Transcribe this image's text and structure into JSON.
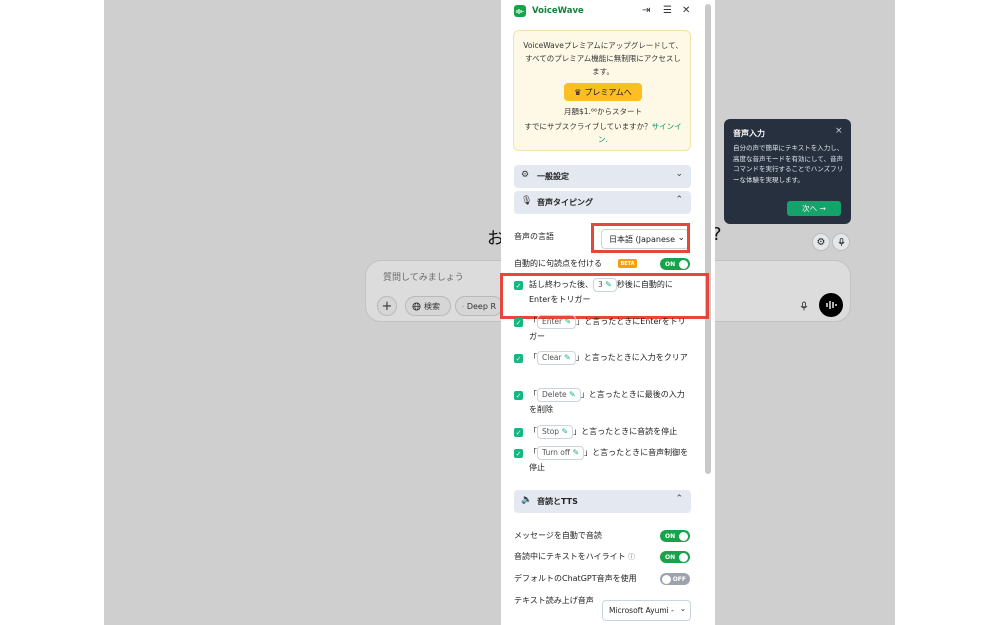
{
  "background": {
    "greeting_left": "お",
    "greeting_right": "?",
    "composer_placeholder": "質問してみましょう",
    "plus_label": "+",
    "search_label": "検索",
    "deep_research_label": "Deep R"
  },
  "tooltip": {
    "title": "音声入力",
    "close": "×",
    "body": "自分の声で簡単にテキストを入力し、高度な音声モードを有効にして、音声コマンドを実行することでハンズフリーな体験を実現します。",
    "next_button": "次へ →"
  },
  "panel": {
    "brand": "VoiceWave",
    "upgrade": {
      "text": "VoiceWaveプレミアムにアップグレードして、すべてのプレミアム機能に無制限にアクセスします。",
      "button": "プレミアムへ",
      "price": "月額$1.⁶⁶からスタート",
      "subscribed_note": "すでにサブスクライブしていますか？",
      "signin": "サインイン."
    },
    "sections": {
      "general": "一般設定",
      "voice_typing": "音声タイピング",
      "read_tts": "音読とTTS"
    },
    "voice_typing": {
      "language_label": "音声の言語",
      "language_value": "日本語 (Japanese",
      "auto_punct_label": "自動的に句読点を付ける",
      "beta": "BETA",
      "auto_punct_toggle": "ON",
      "options": [
        {
          "pre": "話し終わった後、",
          "chip": "3",
          "post": "秒後に自動的にEnterをトリガー"
        },
        {
          "pre": "「",
          "chip": "Enter",
          "post": "」と言ったときにEnterをトリガー"
        },
        {
          "pre": "「",
          "chip": "Clear",
          "post": "」と言ったときに入力をクリア"
        },
        {
          "pre": "「",
          "chip": "Delete",
          "post": "」と言ったときに最後の入力を削除"
        },
        {
          "pre": "「",
          "chip": "Stop",
          "post": "」と言ったときに音読を停止"
        },
        {
          "pre": "「",
          "chip": "Turn off",
          "post": "」と言ったときに音声制御を停止"
        }
      ]
    },
    "tts": {
      "auto_read_label": "メッセージを自動で音読",
      "auto_read_toggle": "ON",
      "highlight_label": "音読中にテキストをハイライト",
      "highlight_toggle": "ON",
      "default_voice_label": "デフォルトのChatGPT音声を使用",
      "default_voice_toggle": "OFF",
      "voice_label": "テキスト読み上げ音声",
      "voice_value": "Microsoft Ayumi -"
    }
  },
  "colors": {
    "accent_green": "#16a34a",
    "highlight_red": "#e5483a",
    "tooltip_bg": "#27303f",
    "premium_yellow": "#fbbf24"
  }
}
